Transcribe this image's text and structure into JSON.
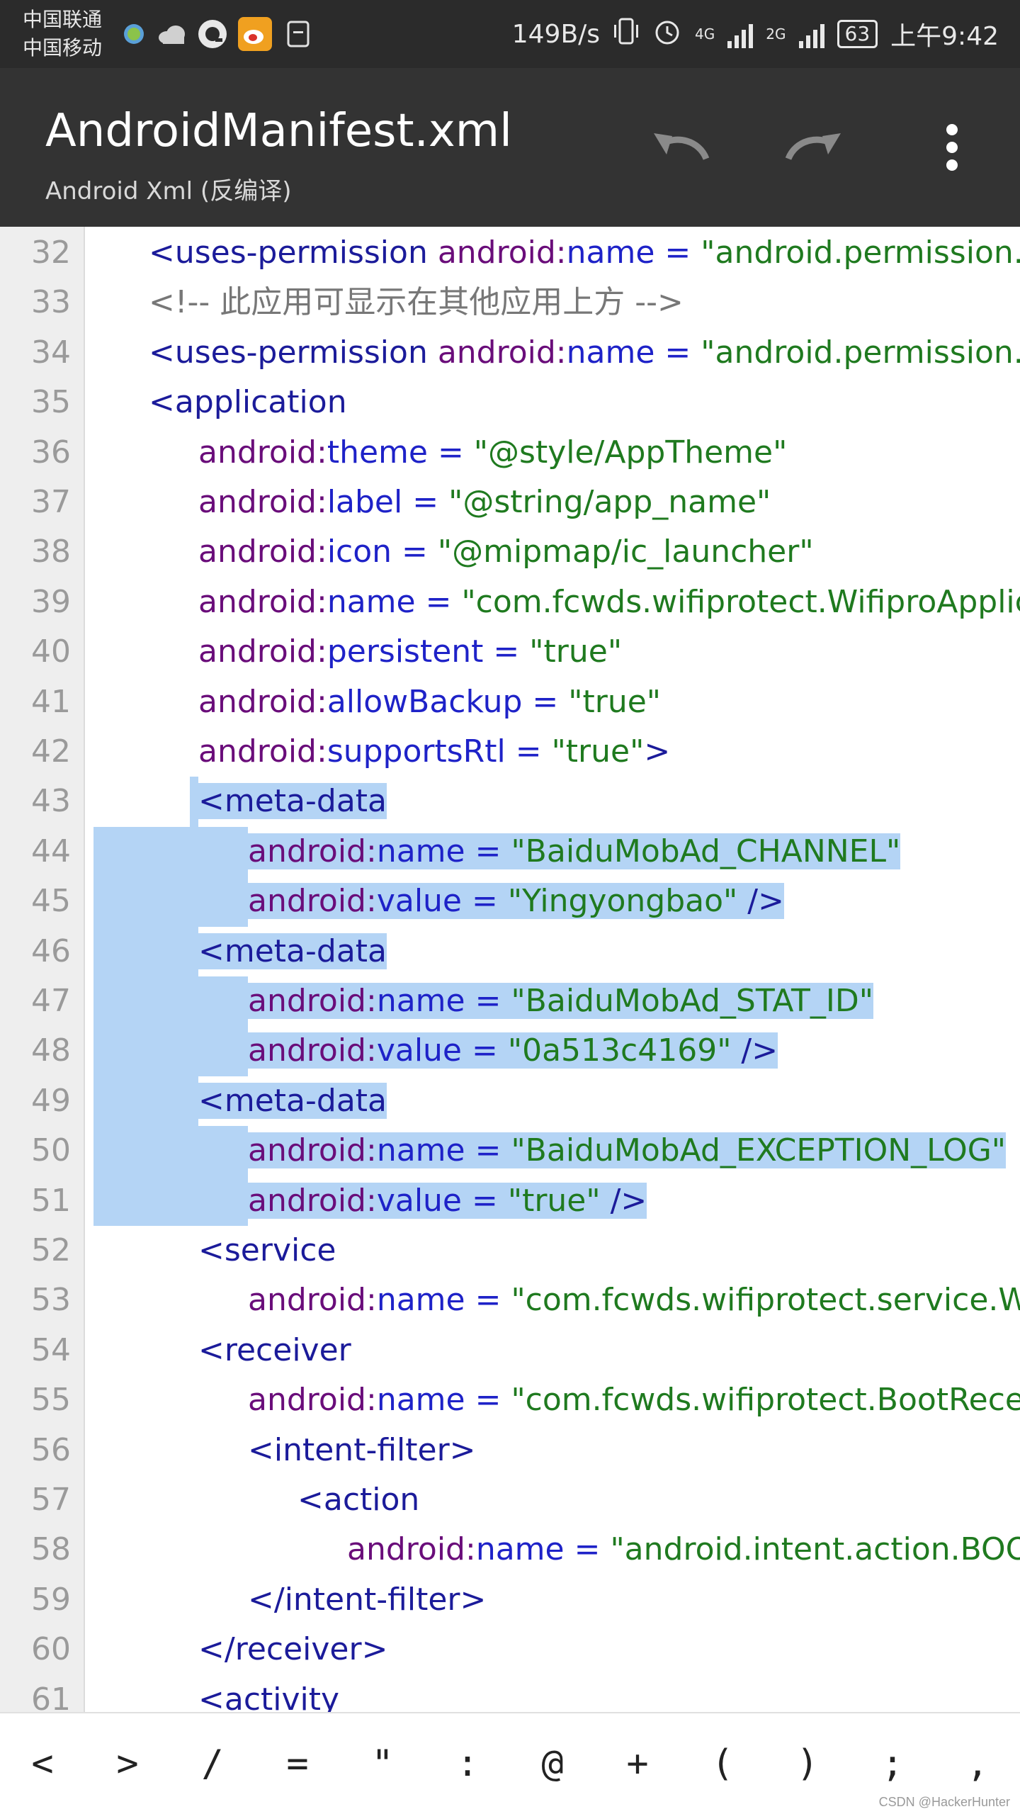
{
  "status_bar": {
    "carrier_1": "中国联通",
    "carrier_2": "中国移动",
    "net_speed": "149B/s",
    "network_1": "4G",
    "network_2": "2G",
    "battery": "63",
    "time": "上午9:42"
  },
  "app_bar": {
    "title": "AndroidManifest.xml",
    "subtitle": "Android Xml (反编译)",
    "undo_label": "undo",
    "redo_label": "redo",
    "more_label": "more"
  },
  "code": {
    "lines": [
      {
        "n": "32",
        "indent": 1,
        "parts": [
          [
            "tag",
            "<uses-permission "
          ],
          [
            "ns",
            "android:"
          ],
          [
            "attr",
            "name"
          ],
          [
            "eq",
            " = "
          ],
          [
            "val",
            "\"android.permission.ACC"
          ]
        ]
      },
      {
        "n": "33",
        "indent": 1,
        "parts": [
          [
            "comment",
            "<!-- 此应用可显示在其他应用上方 -->"
          ]
        ]
      },
      {
        "n": "34",
        "indent": 1,
        "parts": [
          [
            "tag",
            "<uses-permission "
          ],
          [
            "ns",
            "android:"
          ],
          [
            "attr",
            "name"
          ],
          [
            "eq",
            " = "
          ],
          [
            "val",
            "\"android.permission.SYS"
          ]
        ]
      },
      {
        "n": "35",
        "indent": 1,
        "parts": [
          [
            "tag",
            "<application"
          ]
        ]
      },
      {
        "n": "36",
        "indent": 2,
        "parts": [
          [
            "ns",
            "android:"
          ],
          [
            "attr",
            "theme"
          ],
          [
            "eq",
            " = "
          ],
          [
            "val",
            "\"@style/AppTheme\""
          ]
        ]
      },
      {
        "n": "37",
        "indent": 2,
        "parts": [
          [
            "ns",
            "android:"
          ],
          [
            "attr",
            "label"
          ],
          [
            "eq",
            " = "
          ],
          [
            "val",
            "\"@string/app_name\""
          ]
        ]
      },
      {
        "n": "38",
        "indent": 2,
        "parts": [
          [
            "ns",
            "android:"
          ],
          [
            "attr",
            "icon"
          ],
          [
            "eq",
            " = "
          ],
          [
            "val",
            "\"@mipmap/ic_launcher\""
          ]
        ]
      },
      {
        "n": "39",
        "indent": 2,
        "parts": [
          [
            "ns",
            "android:"
          ],
          [
            "attr",
            "name"
          ],
          [
            "eq",
            " = "
          ],
          [
            "val",
            "\"com.fcwds.wifiprotect.WifiproApplicat"
          ]
        ]
      },
      {
        "n": "40",
        "indent": 2,
        "parts": [
          [
            "ns",
            "android:"
          ],
          [
            "attr",
            "persistent"
          ],
          [
            "eq",
            " = "
          ],
          [
            "val",
            "\"true\""
          ]
        ]
      },
      {
        "n": "41",
        "indent": 2,
        "parts": [
          [
            "ns",
            "android:"
          ],
          [
            "attr",
            "allowBackup"
          ],
          [
            "eq",
            " = "
          ],
          [
            "val",
            "\"true\""
          ]
        ]
      },
      {
        "n": "42",
        "indent": 2,
        "parts": [
          [
            "ns",
            "android:"
          ],
          [
            "attr",
            "supportsRtl"
          ],
          [
            "eq",
            " = "
          ],
          [
            "val",
            "\"true\""
          ],
          [
            "tag",
            ">"
          ]
        ]
      },
      {
        "n": "43",
        "indent": 2,
        "parts": [
          [
            "tag",
            "<meta-data"
          ]
        ]
      },
      {
        "n": "44",
        "indent": 3,
        "parts": [
          [
            "ns",
            "android:"
          ],
          [
            "attr",
            "name"
          ],
          [
            "eq",
            " = "
          ],
          [
            "val",
            "\"BaiduMobAd_CHANNEL\""
          ]
        ]
      },
      {
        "n": "45",
        "indent": 3,
        "parts": [
          [
            "ns",
            "android:"
          ],
          [
            "attr",
            "value"
          ],
          [
            "eq",
            " = "
          ],
          [
            "val",
            "\"Yingyongbao\""
          ],
          [
            "tag",
            " />"
          ]
        ]
      },
      {
        "n": "46",
        "indent": 2,
        "parts": [
          [
            "tag",
            "<meta-data"
          ]
        ]
      },
      {
        "n": "47",
        "indent": 3,
        "parts": [
          [
            "ns",
            "android:"
          ],
          [
            "attr",
            "name"
          ],
          [
            "eq",
            " = "
          ],
          [
            "val",
            "\"BaiduMobAd_STAT_ID\""
          ]
        ]
      },
      {
        "n": "48",
        "indent": 3,
        "parts": [
          [
            "ns",
            "android:"
          ],
          [
            "attr",
            "value"
          ],
          [
            "eq",
            " = "
          ],
          [
            "val",
            "\"0a513c4169\""
          ],
          [
            "tag",
            " />"
          ]
        ]
      },
      {
        "n": "49",
        "indent": 2,
        "parts": [
          [
            "tag",
            "<meta-data"
          ]
        ]
      },
      {
        "n": "50",
        "indent": 3,
        "parts": [
          [
            "ns",
            "android:"
          ],
          [
            "attr",
            "name"
          ],
          [
            "eq",
            " = "
          ],
          [
            "val",
            "\"BaiduMobAd_EXCEPTION_LOG\""
          ]
        ]
      },
      {
        "n": "51",
        "indent": 3,
        "parts": [
          [
            "ns",
            "android:"
          ],
          [
            "attr",
            "value"
          ],
          [
            "eq",
            " = "
          ],
          [
            "val",
            "\"true\""
          ],
          [
            "tag",
            " />"
          ]
        ]
      },
      {
        "n": "52",
        "indent": 2,
        "parts": [
          [
            "tag",
            "<service"
          ]
        ]
      },
      {
        "n": "53",
        "indent": 3,
        "parts": [
          [
            "ns",
            "android:"
          ],
          [
            "attr",
            "name"
          ],
          [
            "eq",
            " = "
          ],
          [
            "val",
            "\"com.fcwds.wifiprotect.service.Wifi"
          ]
        ]
      },
      {
        "n": "54",
        "indent": 2,
        "parts": [
          [
            "tag",
            "<receiver"
          ]
        ]
      },
      {
        "n": "55",
        "indent": 3,
        "parts": [
          [
            "ns",
            "android:"
          ],
          [
            "attr",
            "name"
          ],
          [
            "eq",
            " = "
          ],
          [
            "val",
            "\"com.fcwds.wifiprotect.BootReceive"
          ]
        ]
      },
      {
        "n": "56",
        "indent": 3,
        "parts": [
          [
            "tag",
            "<intent-filter>"
          ]
        ]
      },
      {
        "n": "57",
        "indent": 4,
        "parts": [
          [
            "tag",
            "<action"
          ]
        ]
      },
      {
        "n": "58",
        "indent": 5,
        "parts": [
          [
            "ns",
            "android:"
          ],
          [
            "attr",
            "name"
          ],
          [
            "eq",
            " = "
          ],
          [
            "val",
            "\"android.intent.action.BOOT"
          ]
        ]
      },
      {
        "n": "59",
        "indent": 3,
        "parts": [
          [
            "tag",
            "</intent-filter>"
          ]
        ]
      },
      {
        "n": "60",
        "indent": 2,
        "parts": [
          [
            "tag",
            "</receiver>"
          ]
        ]
      },
      {
        "n": "61",
        "indent": 2,
        "parts": [
          [
            "tag",
            "<activity"
          ]
        ]
      }
    ]
  },
  "symbols": [
    "<",
    ">",
    "/",
    "=",
    "\"",
    ":",
    "@",
    "+",
    "(",
    ")",
    ";",
    ","
  ],
  "watermark": "CSDN @HackerHunter"
}
